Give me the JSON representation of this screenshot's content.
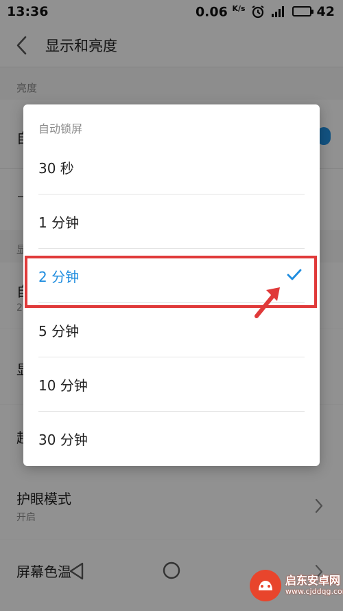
{
  "status_bar": {
    "time": "13:36",
    "speed_value": "0.06",
    "speed_unit": "K/s",
    "battery_level": "42"
  },
  "header": {
    "title": "显示和亮度"
  },
  "settings": {
    "brightness_section": "亮度",
    "brightness_row_partial": "自",
    "display_section_partial": "显",
    "auto_lock_row_partial": "自",
    "auto_lock_sub_partial": "2",
    "display_row_partial": "显",
    "super_row_partial": "超",
    "eye_care": {
      "title": "护眼模式",
      "status": "开启"
    },
    "screen_color_partial": "屏幕色温"
  },
  "dialog": {
    "title": "自动锁屏",
    "options": [
      {
        "label": "30 秒",
        "selected": false
      },
      {
        "label": "1 分钟",
        "selected": false
      },
      {
        "label": "2 分钟",
        "selected": true
      },
      {
        "label": "5 分钟",
        "selected": false
      },
      {
        "label": "10 分钟",
        "selected": false
      },
      {
        "label": "30 分钟",
        "selected": false
      }
    ]
  },
  "watermark": {
    "name": "启东安卓网",
    "url": "www.cjddqg.com"
  },
  "colors": {
    "accent": "#1f8ddf",
    "annotation": "#e03a3a",
    "watermark": "#e8452c"
  }
}
